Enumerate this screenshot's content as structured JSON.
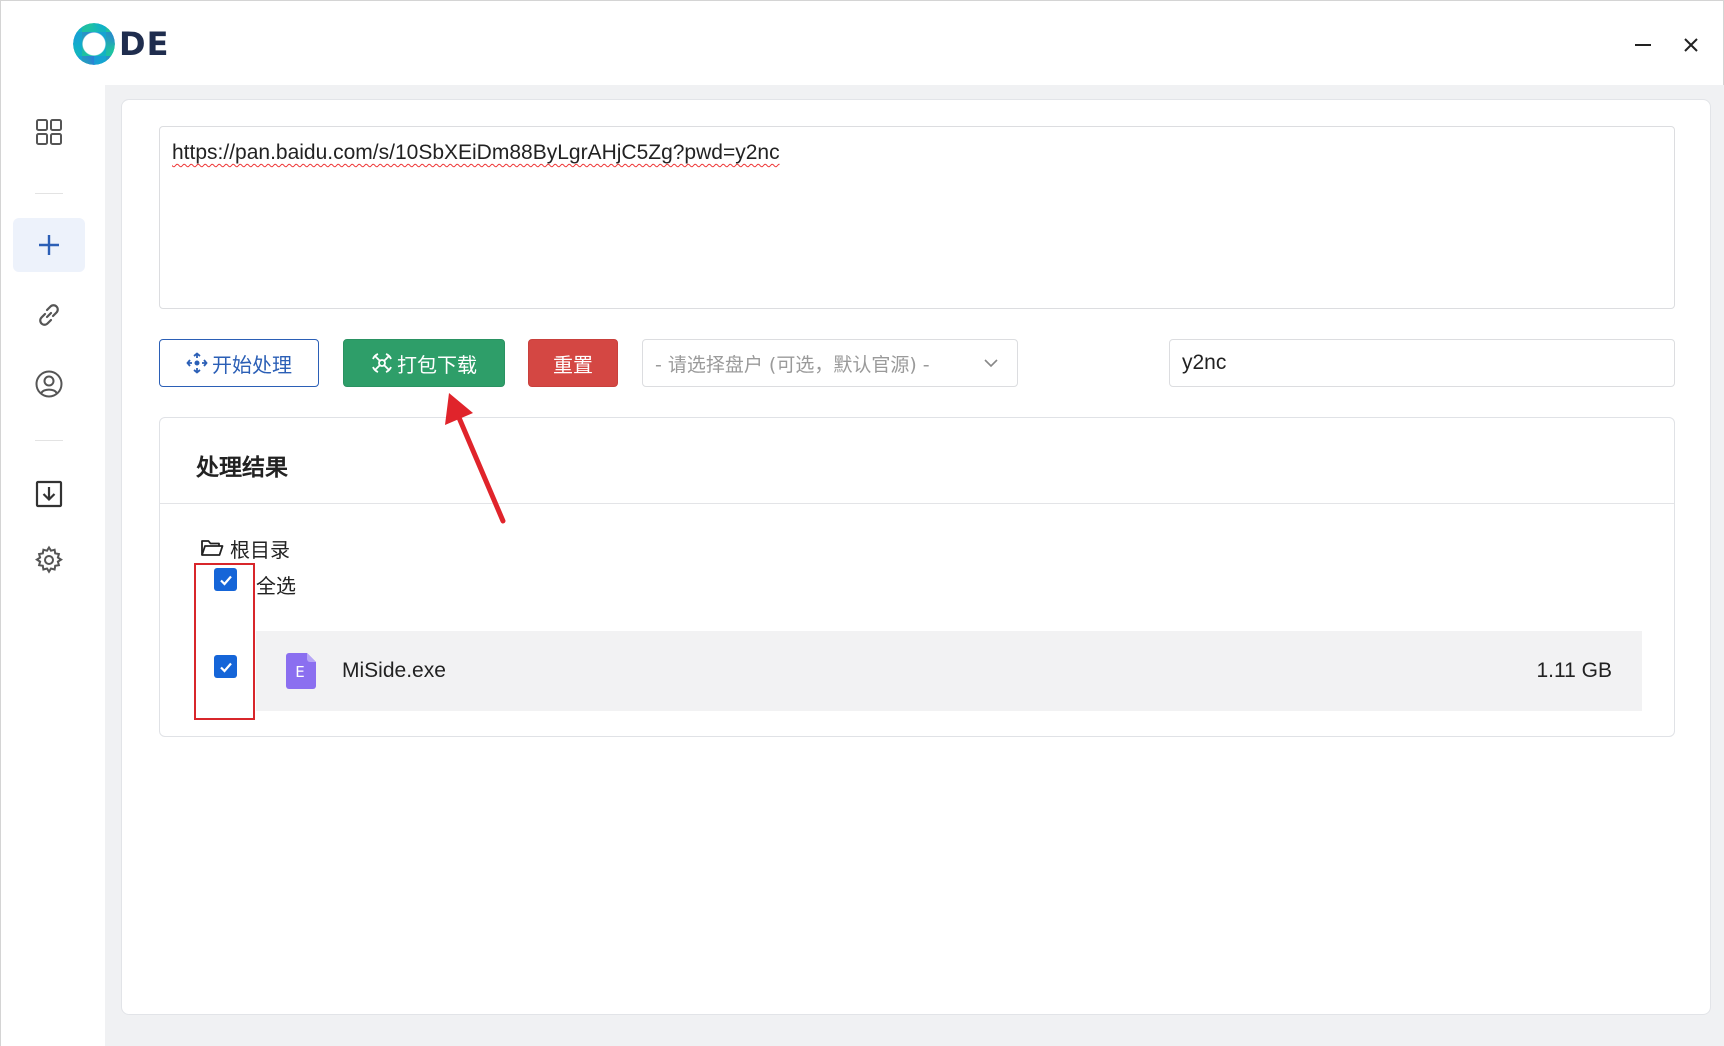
{
  "titlebar": {
    "logo_text": "DE",
    "minimize_symbol": "—",
    "close_symbol": "✕"
  },
  "sidebar": {
    "items": [
      {
        "name": "dashboard",
        "icon": "grid-icon",
        "active": false
      },
      {
        "name": "new-task",
        "icon": "plus-icon",
        "active": true
      },
      {
        "name": "links",
        "icon": "link-icon",
        "active": false
      },
      {
        "name": "account",
        "icon": "user-icon",
        "active": false
      },
      {
        "name": "downloads",
        "icon": "download-icon",
        "active": false
      },
      {
        "name": "settings",
        "icon": "gear-icon",
        "active": false
      }
    ]
  },
  "main": {
    "url_input_value": "https://pan.baidu.com/s/10SbXEiDm88ByLgrAHjC5Zg?pwd=y2nc",
    "buttons": {
      "process_label": "开始处理",
      "download_label": "打包下载",
      "reset_label": "重置"
    },
    "drive_select_placeholder": "- 请选择盘户 (可选，默认官源) -",
    "password_value": "y2nc",
    "results": {
      "title": "处理结果",
      "root_label": "根目录",
      "select_all_label": "全选",
      "select_all_checked": true,
      "files": [
        {
          "icon_letter": "E",
          "name": "MiSide.exe",
          "size": "1.11 GB",
          "checked": true
        }
      ]
    }
  },
  "colors": {
    "primary_blue": "#2b5fb6",
    "download_green": "#2e9e69",
    "reset_red": "#d44743",
    "checkbox_blue": "#1565d8",
    "file_icon_purple": "#8b6ff0",
    "annotation_red": "#d8262b"
  }
}
